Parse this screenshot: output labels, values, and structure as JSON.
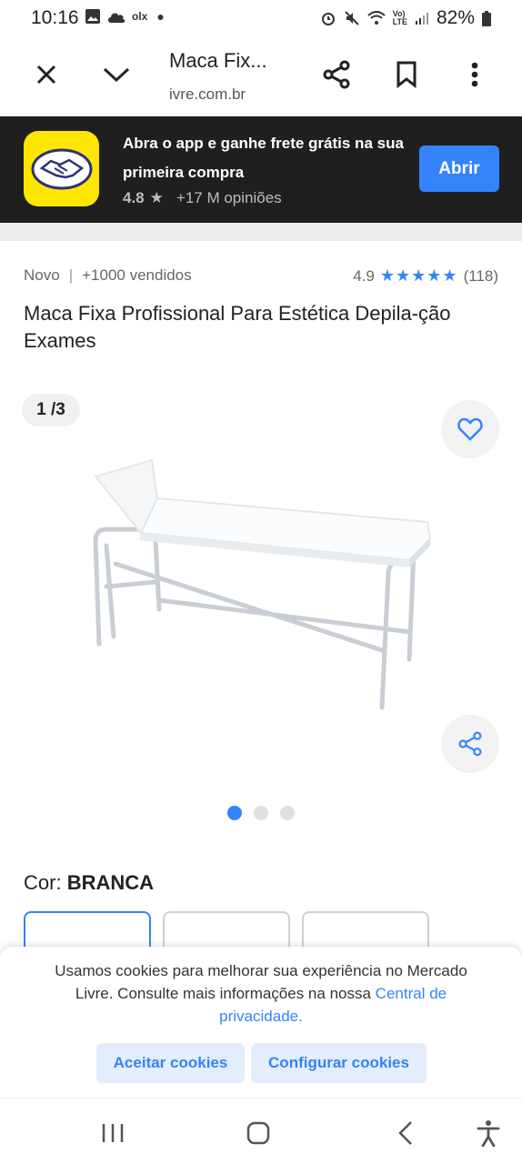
{
  "status_bar": {
    "time": "10:16",
    "app_label": "olx",
    "battery": "82%"
  },
  "browser": {
    "page_title": "Maca Fix...",
    "url": "ivre.com.br"
  },
  "app_banner": {
    "message": "Abra o app e ganhe frete grátis na sua primeira compra",
    "rating": "4.8",
    "reviews": "+17 M opiniões",
    "open_button": "Abrir"
  },
  "product": {
    "condition": "Novo",
    "separator": "|",
    "sold": "+1000 vendidos",
    "rating": "4.9",
    "rating_count": "(118)",
    "title": "Maca Fixa Profissional Para Estética Depila-ção Exames",
    "image_counter": "1 /3",
    "color_label": "Cor:",
    "color_value": "BRANCA"
  },
  "gallery": {
    "total_dots": 3,
    "active_dot": 0
  },
  "cookies": {
    "text": "Usamos cookies para melhorar sua experiência no Mercado Livre. Consulte mais informações na nossa",
    "link": "Central de privacidade.",
    "accept_button": "Aceitar cookies",
    "configure_button": "Configurar cookies"
  },
  "colors": {
    "accent": "#3483fa",
    "banner_bg": "#1f1f1f",
    "brand_yellow": "#ffe600"
  },
  "icons": [
    "close-icon",
    "chevron-down-icon",
    "share-icon",
    "bookmark-icon",
    "more-vert-icon",
    "heart-icon",
    "star-icon",
    "recents-icon",
    "home-icon",
    "back-icon",
    "accessibility-icon"
  ]
}
